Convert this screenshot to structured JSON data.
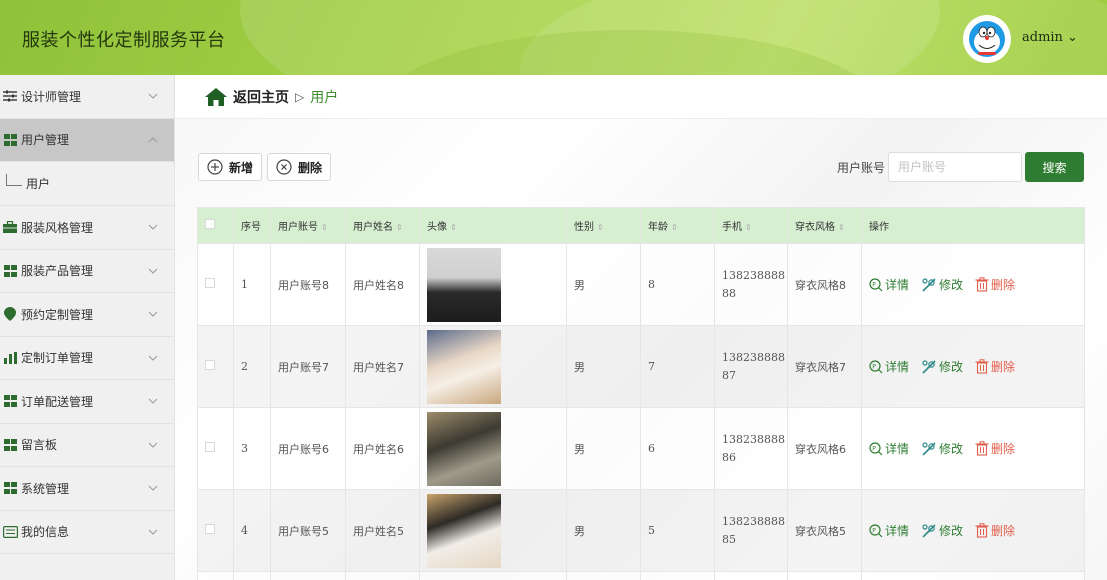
{
  "header": {
    "title": "服装个性化定制服务平台",
    "user": "admin ⌄"
  },
  "sidebar": {
    "items": [
      {
        "label": "设计师管理",
        "icon": "sliders-icon"
      },
      {
        "label": "用户管理",
        "icon": "grid-icon",
        "expanded": true,
        "sub": "用户"
      },
      {
        "label": "服装风格管理",
        "icon": "briefcase-icon"
      },
      {
        "label": "服装产品管理",
        "icon": "grid-icon"
      },
      {
        "label": "预约定制管理",
        "icon": "location-icon"
      },
      {
        "label": "定制订单管理",
        "icon": "bar-chart-icon"
      },
      {
        "label": "订单配送管理",
        "icon": "grid-icon"
      },
      {
        "label": "留言板",
        "icon": "grid-icon"
      },
      {
        "label": "系统管理",
        "icon": "grid-icon"
      },
      {
        "label": "我的信息",
        "icon": "id-card-icon"
      }
    ]
  },
  "breadcrumb": {
    "home": "返回主页",
    "sep": "▷",
    "current": "用户"
  },
  "toolbar": {
    "add_label": "新增",
    "delete_label": "删除",
    "search_label": "用户账号",
    "search_placeholder": "用户账号",
    "search_button": "搜索"
  },
  "table": {
    "headers": [
      "序号",
      "用户账号",
      "用户姓名",
      "头像",
      "性别",
      "年龄",
      "手机",
      "穿衣风格",
      "操作"
    ],
    "rows": [
      {
        "no": "1",
        "account": "用户账号8",
        "name": "用户姓名8",
        "gender": "男",
        "age": "8",
        "phone1": "138238888",
        "phone2": "88",
        "style": "穿衣风格8"
      },
      {
        "no": "2",
        "account": "用户账号7",
        "name": "用户姓名7",
        "gender": "男",
        "age": "7",
        "phone1": "138238888",
        "phone2": "87",
        "style": "穿衣风格7"
      },
      {
        "no": "3",
        "account": "用户账号6",
        "name": "用户姓名6",
        "gender": "男",
        "age": "6",
        "phone1": "138238888",
        "phone2": "86",
        "style": "穿衣风格6"
      },
      {
        "no": "4",
        "account": "用户账号5",
        "name": "用户姓名5",
        "gender": "男",
        "age": "5",
        "phone1": "138238888",
        "phone2": "85",
        "style": "穿衣风格5"
      }
    ],
    "ops": {
      "detail": "详情",
      "edit": "修改",
      "delete": "删除"
    }
  },
  "colors": {
    "accent": "#2e7d32",
    "header_bg": "#a7d247",
    "table_header": "#d7efd1",
    "danger": "#e35d4b"
  }
}
